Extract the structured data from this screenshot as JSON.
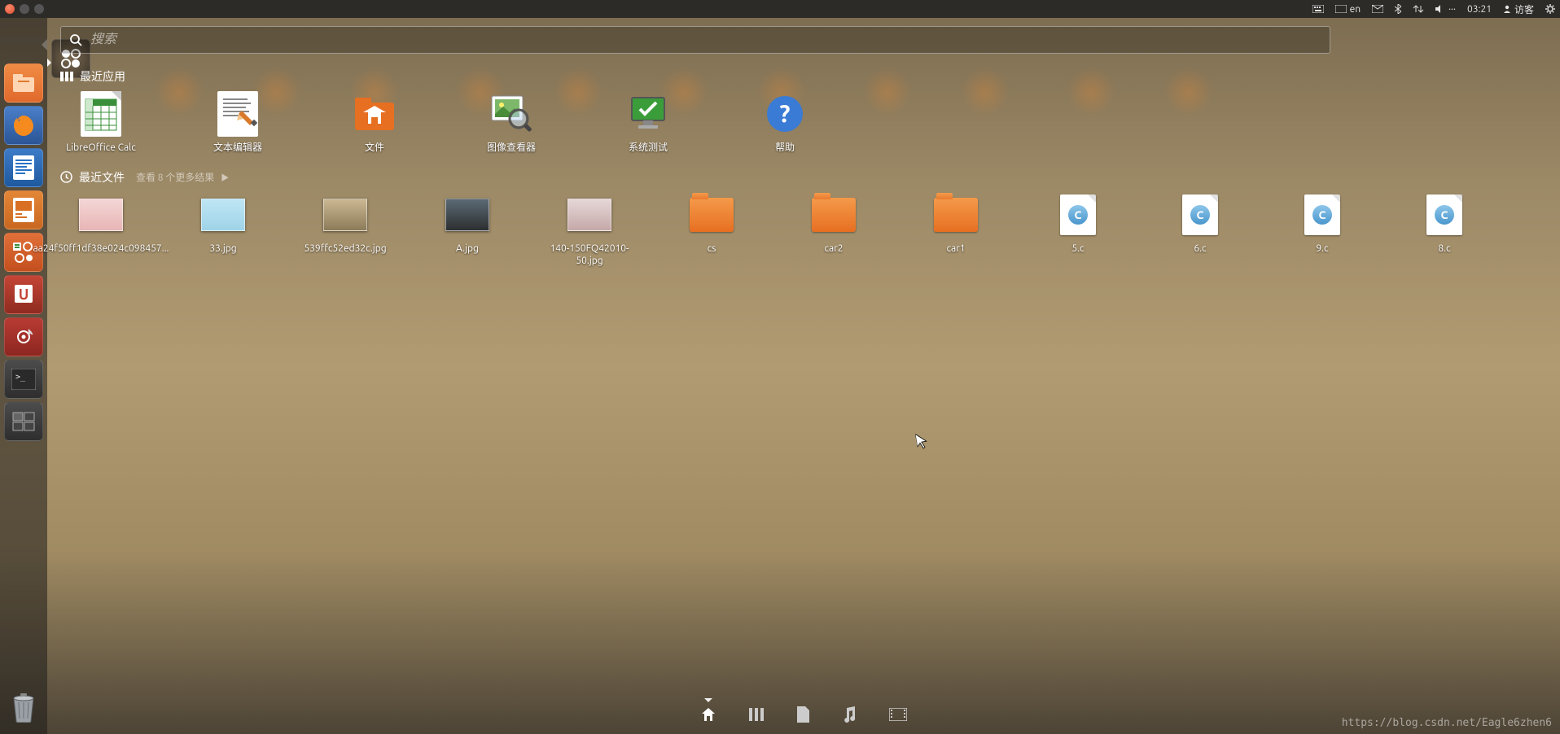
{
  "menubar": {
    "keyboard_layout": "en",
    "time": "03:21",
    "user": "访客"
  },
  "launcher": {
    "items": [
      {
        "name": "dash",
        "style": "dash"
      },
      {
        "name": "files",
        "style": "orange"
      },
      {
        "name": "firefox",
        "style": "blue"
      },
      {
        "name": "libreoffice-writer",
        "style": "blue"
      },
      {
        "name": "libreoffice-impress",
        "style": "orange"
      },
      {
        "name": "libreoffice-calc",
        "style": "orange"
      },
      {
        "name": "ubuntu-software",
        "style": "red"
      },
      {
        "name": "settings",
        "style": "red"
      },
      {
        "name": "terminal",
        "style": "grey"
      },
      {
        "name": "workspace-switcher",
        "style": "grey"
      }
    ]
  },
  "dash": {
    "search_placeholder": "搜索",
    "recent_apps": {
      "title": "最近应用",
      "items": [
        {
          "label": "LibreOffice Calc",
          "icon": "calc"
        },
        {
          "label": "文本编辑器",
          "icon": "gedit"
        },
        {
          "label": "文件",
          "icon": "files"
        },
        {
          "label": "图像查看器",
          "icon": "image-viewer"
        },
        {
          "label": "系统测试",
          "icon": "system-test"
        },
        {
          "label": "帮助",
          "icon": "help"
        }
      ]
    },
    "recent_files": {
      "title": "最近文件",
      "more_hint": "查看 8 个更多结果",
      "items": [
        {
          "label": "aa24f50ff1df38e024c098457...",
          "type": "image",
          "thumb": "t1"
        },
        {
          "label": "33.jpg",
          "type": "image",
          "thumb": "t2"
        },
        {
          "label": "539ffc52ed32c.jpg",
          "type": "image",
          "thumb": "t3"
        },
        {
          "label": "A.jpg",
          "type": "image",
          "thumb": "t4"
        },
        {
          "label": "140-150FQ42010-50.jpg",
          "type": "image",
          "thumb": "t5"
        },
        {
          "label": "cs",
          "type": "folder"
        },
        {
          "label": "car2",
          "type": "folder"
        },
        {
          "label": "car1",
          "type": "folder"
        },
        {
          "label": "5.c",
          "type": "c"
        },
        {
          "label": "6.c",
          "type": "c"
        },
        {
          "label": "9.c",
          "type": "c"
        },
        {
          "label": "8.c",
          "type": "c"
        }
      ]
    },
    "lenses": [
      "home",
      "applications",
      "files",
      "music",
      "video"
    ]
  },
  "watermark": "https://blog.csdn.net/Eagle6zhen6"
}
